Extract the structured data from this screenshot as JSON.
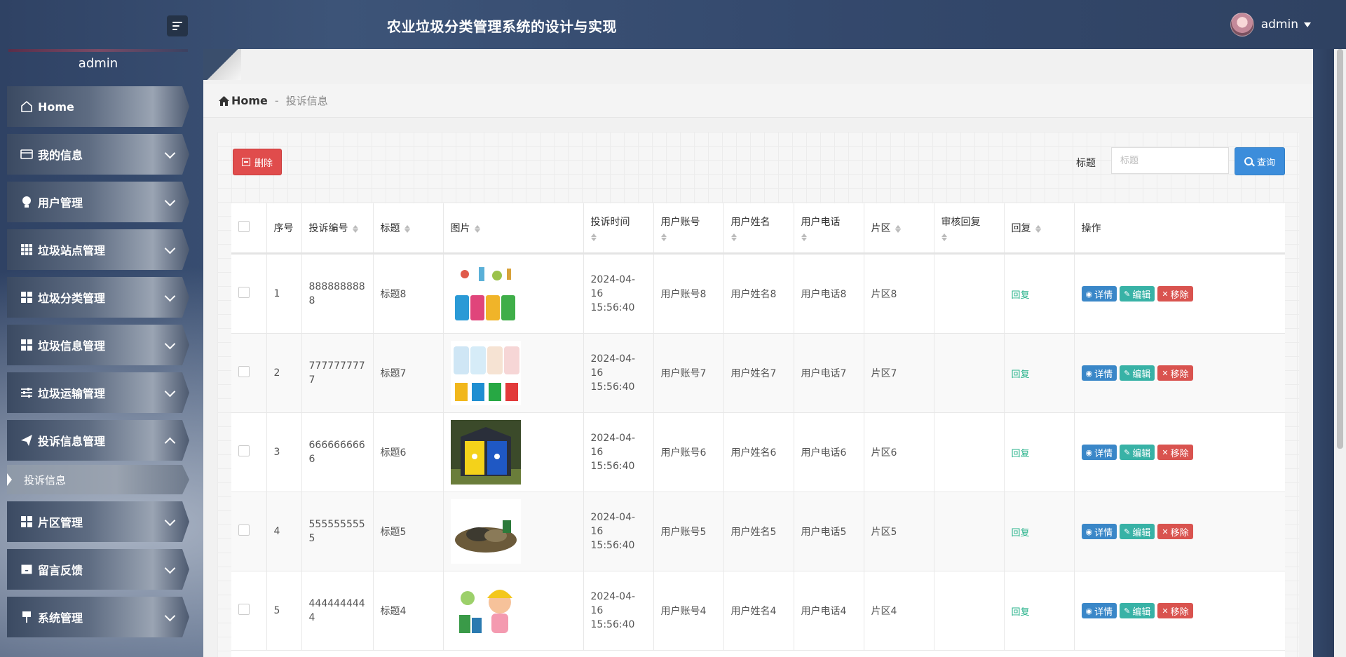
{
  "header": {
    "system_title": "农业垃圾分类管理系统的设计与实现",
    "user_name": "admin"
  },
  "sidebar": {
    "user_name": "admin",
    "items": [
      {
        "label": "Home",
        "icon": "home-icon"
      },
      {
        "label": "我的信息",
        "icon": "id-card-icon"
      },
      {
        "label": "用户管理",
        "icon": "bulb-icon"
      },
      {
        "label": "垃圾站点管理",
        "icon": "grid-icon"
      },
      {
        "label": "垃圾分类管理",
        "icon": "grid-icon"
      },
      {
        "label": "垃圾信息管理",
        "icon": "grid-icon"
      },
      {
        "label": "垃圾运输管理",
        "icon": "sliders-icon"
      },
      {
        "label": "投诉信息管理",
        "icon": "paper-plane-icon"
      },
      {
        "label": "片区管理",
        "icon": "grid-icon"
      },
      {
        "label": "留言反馈",
        "icon": "inbox-icon"
      },
      {
        "label": "系统管理",
        "icon": "pin-icon"
      }
    ],
    "sub_item": "投诉信息"
  },
  "breadcrumb": {
    "home": "Home",
    "separator": "-",
    "current": "投诉信息"
  },
  "toolbar": {
    "delete_label": "删除",
    "search_label": "标题",
    "search_placeholder": "标题",
    "query_label": "查询"
  },
  "table": {
    "headers": [
      "序号",
      "投诉编号",
      "标题",
      "图片",
      "投诉时间",
      "用户账号",
      "用户姓名",
      "用户电话",
      "片区",
      "审核回复",
      "回复",
      "操作"
    ],
    "rows": [
      {
        "idx": "1",
        "code": "8888888888",
        "title": "标题8",
        "time": "2024-04-16 15:56:40",
        "account": "用户账号8",
        "name": "用户姓名8",
        "phone": "用户电话8",
        "area": "片区8",
        "review": "",
        "reply": "回复"
      },
      {
        "idx": "2",
        "code": "7777777777",
        "title": "标题7",
        "time": "2024-04-16 15:56:40",
        "account": "用户账号7",
        "name": "用户姓名7",
        "phone": "用户电话7",
        "area": "片区7",
        "review": "",
        "reply": "回复"
      },
      {
        "idx": "3",
        "code": "6666666666",
        "title": "标题6",
        "time": "2024-04-16 15:56:40",
        "account": "用户账号6",
        "name": "用户姓名6",
        "phone": "用户电话6",
        "area": "片区6",
        "review": "",
        "reply": "回复"
      },
      {
        "idx": "4",
        "code": "5555555555",
        "title": "标题5",
        "time": "2024-04-16 15:56:40",
        "account": "用户账号5",
        "name": "用户姓名5",
        "phone": "用户电话5",
        "area": "片区5",
        "review": "",
        "reply": "回复"
      },
      {
        "idx": "5",
        "code": "4444444444",
        "title": "标题4",
        "time": "2024-04-16 15:56:40",
        "account": "用户账号4",
        "name": "用户姓名4",
        "phone": "用户电话4",
        "area": "片区4",
        "review": "",
        "reply": "回复"
      }
    ],
    "actions": {
      "detail": "详情",
      "edit": "编辑",
      "remove": "移除"
    }
  },
  "colors": {
    "delete": "#e04c4c",
    "query": "#3c8ddb",
    "detail": "#3a87c8",
    "edit": "#38b2a6",
    "remove": "#d9534f",
    "reply": "#26b28a"
  }
}
